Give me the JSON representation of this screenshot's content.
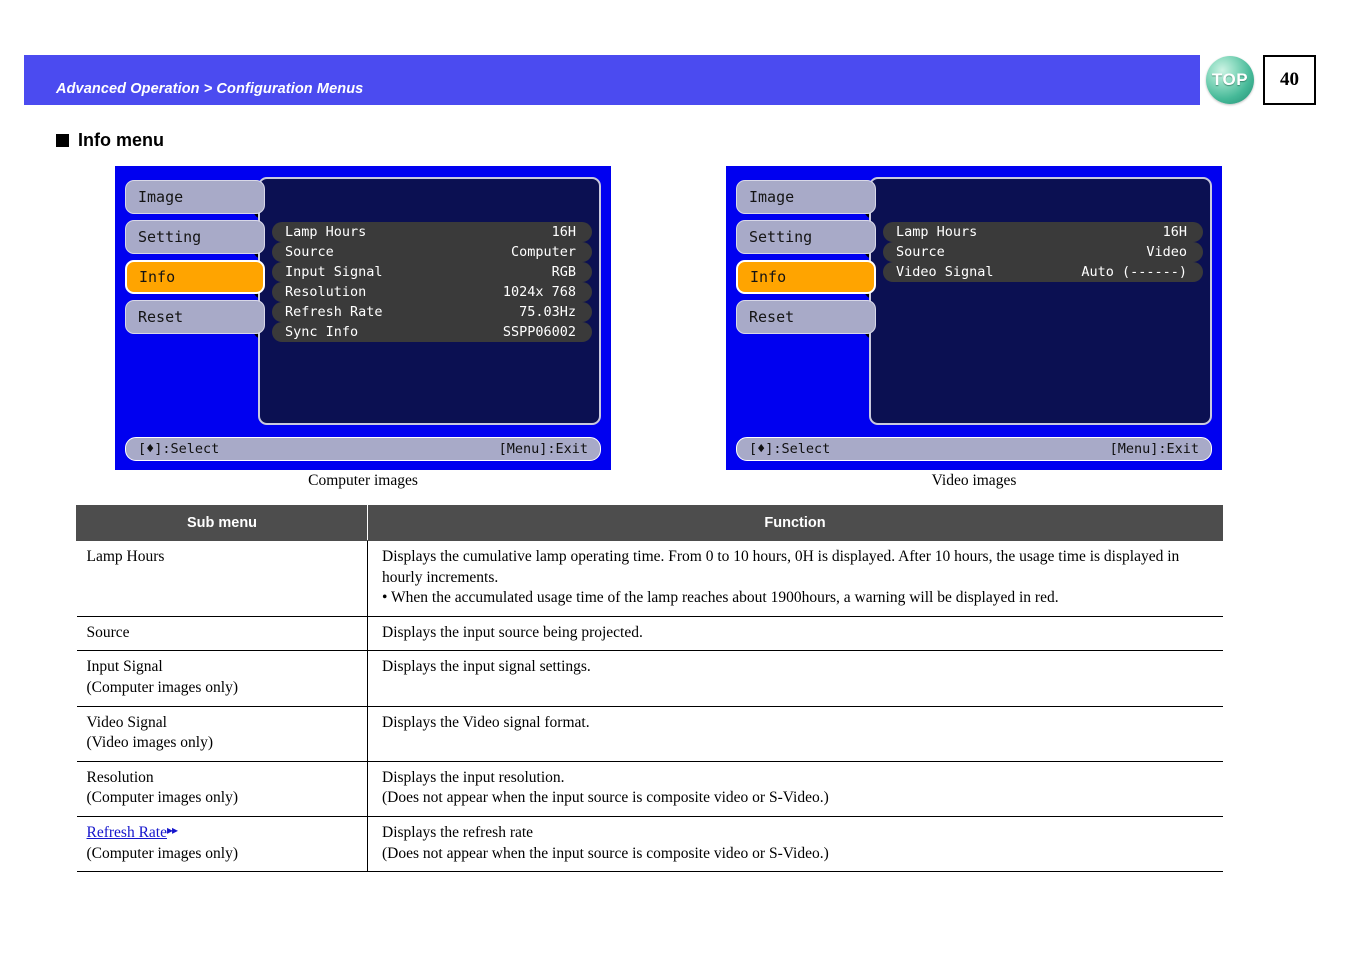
{
  "header": {
    "breadcrumb": "Advanced Operation > Configuration Menus",
    "top_button_label": "TOP",
    "page_number": "40",
    "banner_color": "#4b4bf0"
  },
  "section": {
    "title": "Info menu"
  },
  "osd_screens": [
    {
      "id": "computer",
      "caption": "Computer images",
      "tabs": [
        {
          "label": "Image",
          "active": false
        },
        {
          "label": "Setting",
          "active": false
        },
        {
          "label": "Info",
          "active": true
        },
        {
          "label": "Reset",
          "active": false
        }
      ],
      "rows": [
        {
          "label": "Lamp Hours",
          "value": "16H"
        },
        {
          "label": "Source",
          "value": "Computer"
        },
        {
          "label": "Input Signal",
          "value": "RGB"
        },
        {
          "label": "Resolution",
          "value": "1024x 768"
        },
        {
          "label": "Refresh Rate",
          "value": "75.03Hz"
        },
        {
          "label": "Sync Info",
          "value": "SSPP06002"
        }
      ],
      "guide_left": "[♦]:Select",
      "guide_right": "[Menu]:Exit"
    },
    {
      "id": "video",
      "caption": "Video images",
      "tabs": [
        {
          "label": "Image",
          "active": false
        },
        {
          "label": "Setting",
          "active": false
        },
        {
          "label": "Info",
          "active": true
        },
        {
          "label": "Reset",
          "active": false
        }
      ],
      "rows": [
        {
          "label": "Lamp Hours",
          "value": "16H"
        },
        {
          "label": "Source",
          "value": "Video"
        },
        {
          "label": "Video Signal",
          "value": "Auto (------)"
        }
      ],
      "guide_left": "[♦]:Select",
      "guide_right": "[Menu]:Exit"
    }
  ],
  "table": {
    "headers": {
      "sub_menu": "Sub menu",
      "function": "Function"
    },
    "rows": [
      {
        "sub_menu": "Lamp Hours",
        "sub_note": "",
        "is_link": false,
        "function_lines": [
          "Displays the cumulative lamp operating time. From 0 to 10 hours, 0H is displayed. After 10 hours, the usage time is displayed in hourly increments.",
          "• When the accumulated usage time of the lamp reaches about 1900hours, a warning will be displayed in red."
        ]
      },
      {
        "sub_menu": "Source",
        "sub_note": "",
        "is_link": false,
        "function_lines": [
          "Displays the input source being projected."
        ]
      },
      {
        "sub_menu": "Input Signal",
        "sub_note": "(Computer images only)",
        "is_link": false,
        "function_lines": [
          "Displays the input signal settings."
        ]
      },
      {
        "sub_menu": "Video Signal",
        "sub_note": "(Video images only)",
        "is_link": false,
        "function_lines": [
          "Displays the Video signal format."
        ]
      },
      {
        "sub_menu": "Resolution",
        "sub_note": "(Computer images only)",
        "is_link": false,
        "function_lines": [
          "Displays the input resolution.",
          "(Does not appear when  the input source is composite video or S-Video.)"
        ]
      },
      {
        "sub_menu": "Refresh Rate",
        "sub_note": "(Computer images only)",
        "is_link": true,
        "link_arrow": "▸▸",
        "function_lines": [
          "Displays the refresh rate",
          "(Does not appear when  the input source is composite video or S-Video.)"
        ]
      }
    ]
  }
}
